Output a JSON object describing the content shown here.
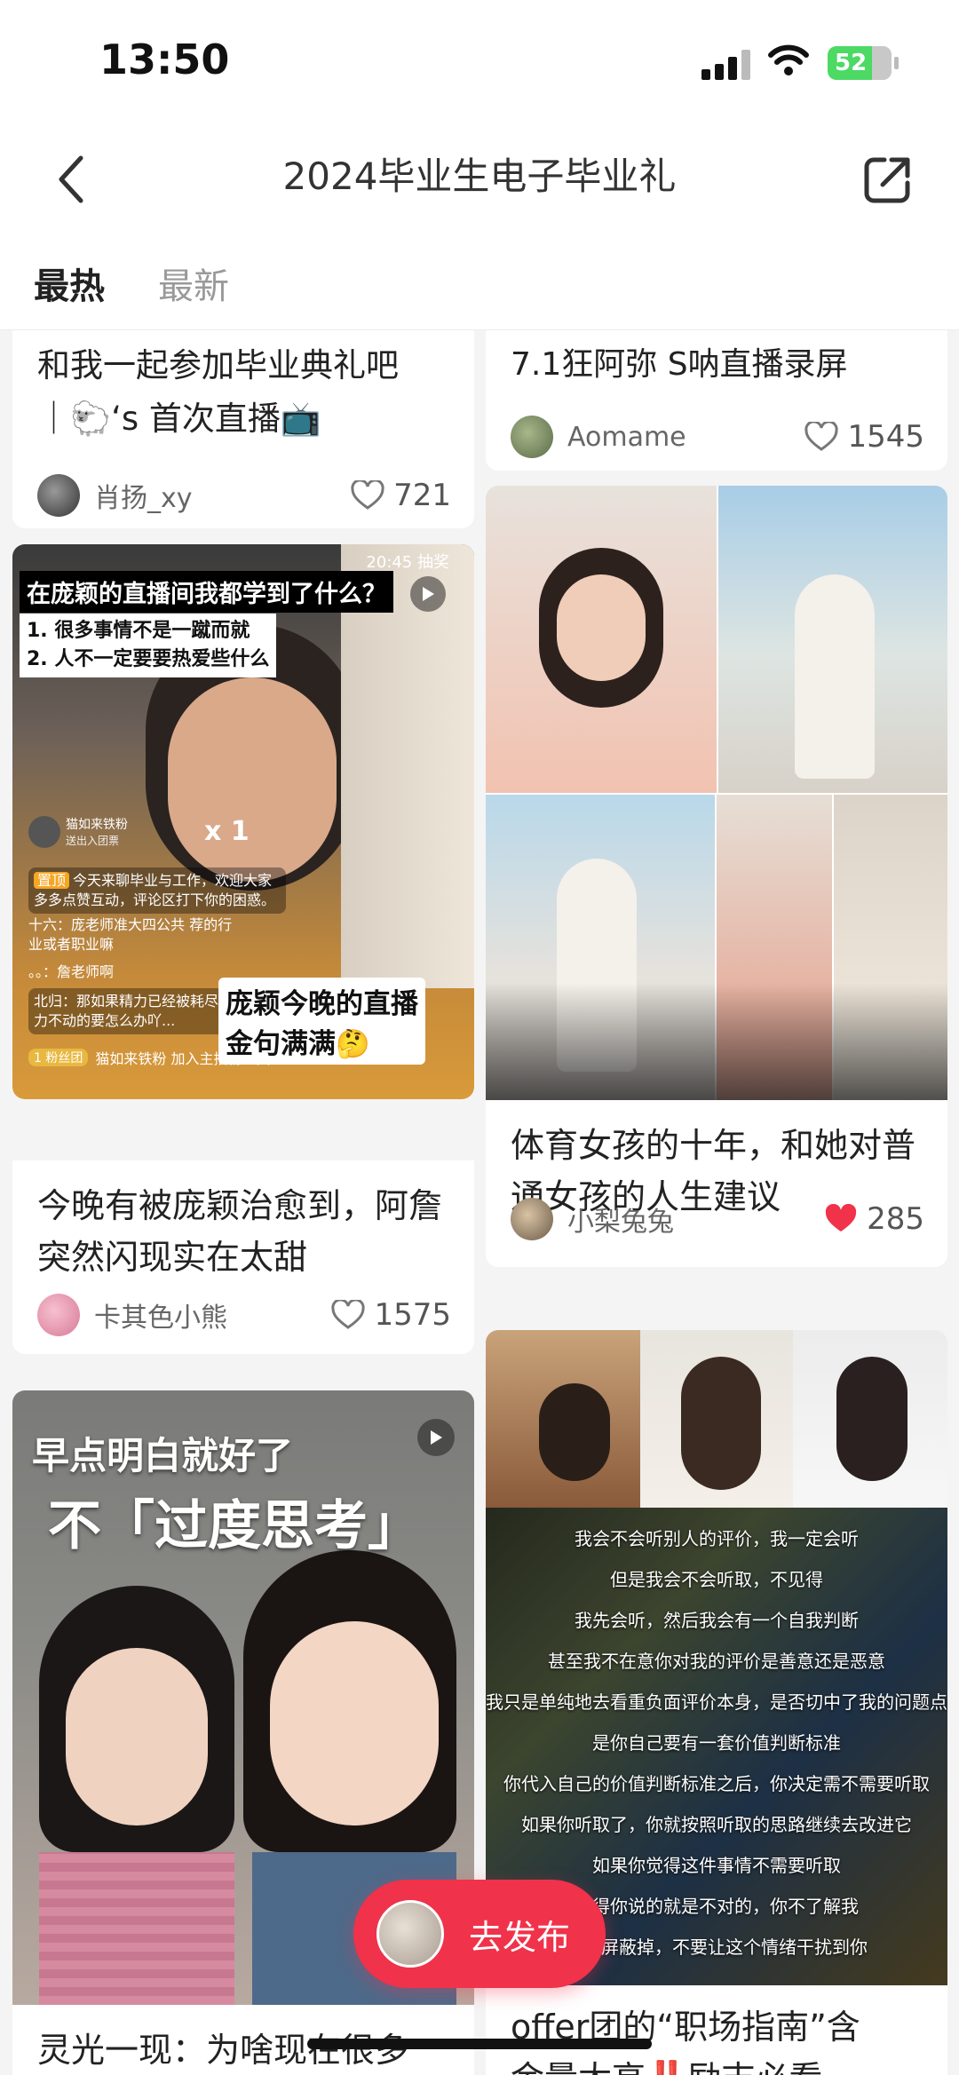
{
  "status": {
    "time": "13:50",
    "battery": "52"
  },
  "nav": {
    "title": "2024毕业生电子毕业礼"
  },
  "tabs": [
    {
      "label": "最热",
      "active": true
    },
    {
      "label": "最新",
      "active": false
    }
  ],
  "cards": {
    "left_top": {
      "title_line1": "和我一起参加毕业典礼吧",
      "title_line2": "｜🐑‘s 首次直播📺",
      "author": "肖扬_xy",
      "likes": "721"
    },
    "right_top": {
      "title": "7.1狂阿弥 S呐直播录屏",
      "author": "Aomame",
      "likes": "1545"
    },
    "left_mid": {
      "overlay_header": "在庞颖的直播间我都学到了什么？",
      "overlay_list": [
        "1. 很多事情不是一蹴而就",
        "2. 人不一定要要热爱些什么"
      ],
      "overlay_corner": "20:45 抽奖",
      "sticker_text_line1": "庞颖今晚的直播",
      "sticker_text_line2": "金句满满🤔",
      "chat_pin_tag": "置顶",
      "chat_pin": "今天来聊毕业与工作，欢迎大家多多点赞互动，评论区打下你的困惑。",
      "chat_1": "十六：庞老师准大四公共 荐的行业或者职业嘛",
      "chat_2": "。。：詹老师啊",
      "chat_3": "北归：那如果精力已经被耗尽了完全努力不动的要怎么办吖...",
      "chat_4": "猫如来铁粉 加入主播粉丝团",
      "fan_badge": "1 粉丝团",
      "gift_user": "猫如来铁粉",
      "gift_desc": "送出入团票",
      "gift_count": "x 1",
      "title": "今晚有被庞颖治愈到，阿詹突然闪现实在太甜",
      "author": "卡其色小熊",
      "likes": "1575"
    },
    "right_mid": {
      "title": "体育女孩的十年，和她对普通女孩的人生建议",
      "author": "小梨兔兔",
      "likes": "285",
      "liked": true
    },
    "left_bottom": {
      "overlay_line1": "早点明白就好了",
      "overlay_line2": "不「过度思考」",
      "title": "灵光一现：为啥现在很多"
    },
    "right_bottom": {
      "subtitles": [
        "我会不会听别人的评价，我一定会听",
        "但是我会不会听取，不见得",
        "我先会听，然后我会有一个自我判断",
        "甚至我不在意你对我的评价是善意还是恶意",
        "我只是单纯地去看重负面评价本身，是否切中了我的问题点",
        "是你自己要有一套价值判断标准",
        "你代入自己的价值判断标准之后，你决定需不需要听取",
        "如果你听取了，你就按照听取的思路继续去改进它",
        "如果你觉得这件事情不需要听取",
        "觉得你说的就是不对的，你不了解我",
        "事情屏蔽掉，不要让这个情绪干扰到你"
      ],
      "title_line1": "offer团的“职场指南”含",
      "title_line2": "金量太高‼️励志必看"
    }
  },
  "publish": {
    "label": "去发布"
  },
  "colors": {
    "accent": "#f0324a",
    "liked_heart": "#f0324a"
  }
}
